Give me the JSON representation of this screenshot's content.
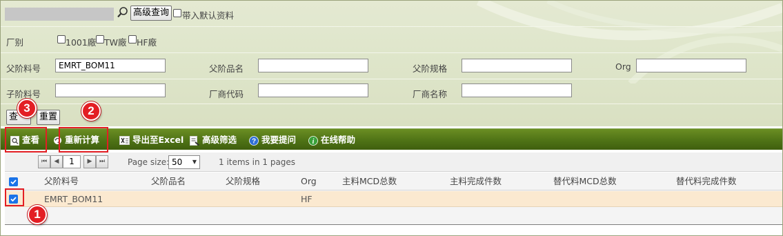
{
  "top": {
    "advanced_query_label": "高级查询",
    "include_default_label": "带入默认资料"
  },
  "plant": {
    "label": "厂别",
    "options": [
      "1001廠",
      "TW廠",
      "HF廠"
    ]
  },
  "fields": {
    "parent_part_no": {
      "label": "父阶料号",
      "value": "EMRT_BOM11"
    },
    "parent_name": {
      "label": "父阶品名",
      "value": ""
    },
    "parent_spec": {
      "label": "父阶规格",
      "value": ""
    },
    "org": {
      "label": "Org",
      "value": ""
    },
    "child_part_no": {
      "label": "子阶料号",
      "value": ""
    },
    "vendor_code": {
      "label": "厂商代码",
      "value": ""
    },
    "vendor_name": {
      "label": "厂商名称",
      "value": ""
    }
  },
  "actions": {
    "query_label": "查询",
    "query_visible": "查",
    "reset_label": "重置"
  },
  "toolbar": {
    "view": "查看",
    "recalc": "重新计算",
    "export": "导出至Excel",
    "adv_filter": "高级筛选",
    "ask": "我要提问",
    "help": "在线帮助"
  },
  "pager": {
    "current_page": "1",
    "page_size_label": "Page size:",
    "page_size": "50",
    "summary": "1 items in 1 pages"
  },
  "grid": {
    "columns": [
      "父阶料号",
      "父阶品名",
      "父阶规格",
      "Org",
      "主料MCD总数",
      "主料完成件数",
      "替代料MCD总数",
      "替代料完成件数"
    ],
    "rows": [
      {
        "parent_part_no": "EMRT_BOM11",
        "org": "HF",
        "checked": true
      }
    ]
  },
  "annotations": [
    "1",
    "2",
    "3"
  ],
  "colors": {
    "toolbar_green": "#4f7316",
    "annotation_red": "#e31e24",
    "row_highlight": "#fbe9d0",
    "checkbox_blue": "#1a73e8"
  }
}
